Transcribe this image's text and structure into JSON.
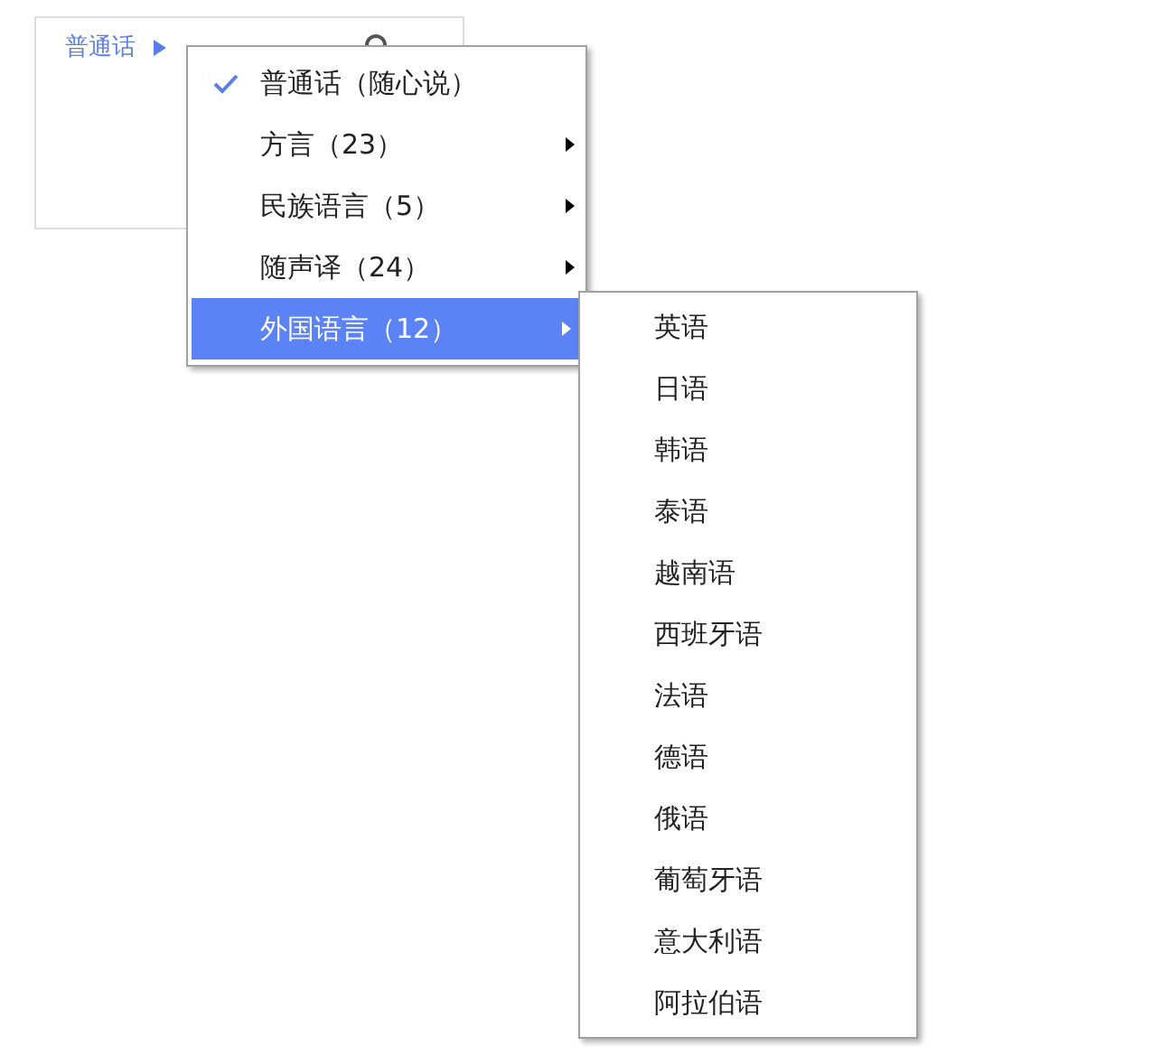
{
  "panel": {
    "language_link": "普通话"
  },
  "menu": {
    "items": [
      {
        "label": "普通话（随心说）",
        "checked": true,
        "has_submenu": false,
        "selected": false
      },
      {
        "label": "方言（23）",
        "checked": false,
        "has_submenu": true,
        "selected": false
      },
      {
        "label": "民族语言（5）",
        "checked": false,
        "has_submenu": true,
        "selected": false
      },
      {
        "label": "随声译（24）",
        "checked": false,
        "has_submenu": true,
        "selected": false
      },
      {
        "label": "外国语言（12）",
        "checked": false,
        "has_submenu": true,
        "selected": true
      }
    ]
  },
  "submenu": {
    "items": [
      {
        "label": "英语"
      },
      {
        "label": "日语"
      },
      {
        "label": "韩语"
      },
      {
        "label": "泰语"
      },
      {
        "label": "越南语"
      },
      {
        "label": "西班牙语"
      },
      {
        "label": "法语"
      },
      {
        "label": "德语"
      },
      {
        "label": "俄语"
      },
      {
        "label": "葡萄牙语"
      },
      {
        "label": "意大利语"
      },
      {
        "label": "阿拉伯语"
      }
    ]
  }
}
